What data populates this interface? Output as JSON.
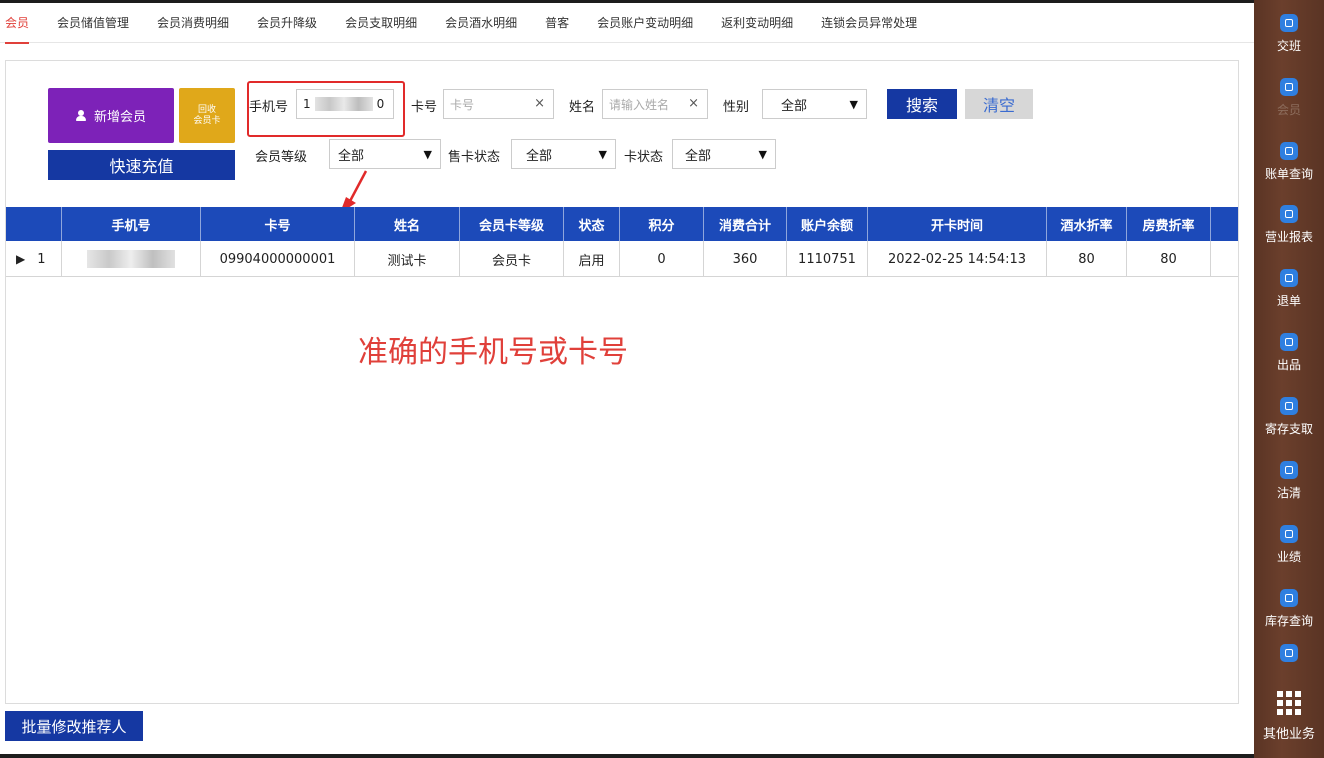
{
  "tabs": [
    {
      "label": "会员",
      "active": true
    },
    {
      "label": "会员储值管理"
    },
    {
      "label": "会员消费明细"
    },
    {
      "label": "会员升降级"
    },
    {
      "label": "会员支取明细"
    },
    {
      "label": "会员酒水明细"
    },
    {
      "label": "普客"
    },
    {
      "label": "会员账户变动明细"
    },
    {
      "label": "返利变动明细"
    },
    {
      "label": "连锁会员异常处理"
    }
  ],
  "actions": {
    "add_member": "新增会员",
    "recycle_line1": "回收",
    "recycle_line2": "会员卡",
    "quick_recharge": "快速充值",
    "search": "搜索",
    "clear": "清空",
    "batch_modify": "批量修改推荐人"
  },
  "filters": {
    "phone_label": "手机号",
    "phone_value_start": "1",
    "phone_value_end": "0",
    "card_label": "卡号",
    "card_placeholder": "卡号",
    "name_label": "姓名",
    "name_placeholder": "请输入姓名",
    "gender_label": "性别",
    "gender_value": "全部",
    "level_label": "会员等级",
    "level_value": "全部",
    "sale_status_label": "售卡状态",
    "sale_status_value": "全部",
    "card_status_label": "卡状态",
    "card_status_value": "全部"
  },
  "table": {
    "columns": [
      "",
      "手机号",
      "卡号",
      "姓名",
      "会员卡等级",
      "状态",
      "积分",
      "消费合计",
      "账户余额",
      "开卡时间",
      "酒水折率",
      "房费折率"
    ],
    "rows": [
      {
        "index": "1",
        "card": "09904000000001",
        "name": "测试卡",
        "level": "会员卡",
        "status": "启用",
        "points": "0",
        "spend_total": "360",
        "balance": "1110751",
        "open_time": "2022-02-25 14:54:13",
        "drink_rate": "80",
        "room_rate": "80"
      }
    ]
  },
  "annotation": "准确的手机号或卡号",
  "colors": {
    "accent_red": "#e0403a",
    "primary_blue": "#1538a2",
    "header_blue": "#1c4ab9",
    "purple": "#7d22b8",
    "gold": "#e0a81a"
  },
  "sidebar": [
    {
      "label": "交班",
      "icon": "handover-icon"
    },
    {
      "label": "会员",
      "icon": "member-icon",
      "dim": true
    },
    {
      "label": "账单查询",
      "icon": "bill-icon"
    },
    {
      "label": "营业报表",
      "icon": "report-icon"
    },
    {
      "label": "退单",
      "icon": "refund-icon"
    },
    {
      "label": "出品",
      "icon": "output-icon"
    },
    {
      "label": "寄存支取",
      "icon": "storage-icon"
    },
    {
      "label": "沽清",
      "icon": "soldout-icon"
    },
    {
      "label": "业绩",
      "icon": "performance-icon"
    },
    {
      "label": "库存查询",
      "icon": "inventory-icon"
    },
    {
      "label": "",
      "icon": "download-icon"
    },
    {
      "label": "其他业务",
      "icon": "grid-icon"
    }
  ]
}
